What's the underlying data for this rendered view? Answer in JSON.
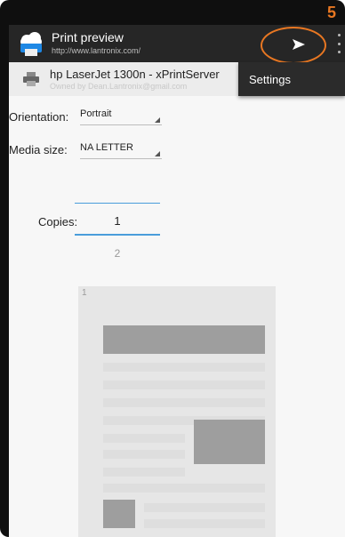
{
  "step_marker": "5",
  "actionbar": {
    "title": "Print preview",
    "subtitle": "http://www.lantronix.com/",
    "app_icon": "cloud-printer-icon",
    "send_icon": "send-icon",
    "overflow_icon": "overflow-menu-icon"
  },
  "printer": {
    "name": "hp LaserJet 1300n - xPrintServer",
    "owner": "Owned by Dean.Lantronix@gmail.com",
    "icon": "printer-icon"
  },
  "menu": {
    "settings_label": "Settings"
  },
  "options": {
    "orientation_label": "Orientation:",
    "orientation_value": "Portrait",
    "media_label": "Media size:",
    "media_value": "NA LETTER",
    "copies_label": "Copies:",
    "copies_value": "1",
    "pages_count": "2"
  },
  "preview": {
    "page_number": "1"
  },
  "colors": {
    "accent": "#e87722",
    "field_underline": "#4a9ddb",
    "actionbar": "#262626"
  }
}
